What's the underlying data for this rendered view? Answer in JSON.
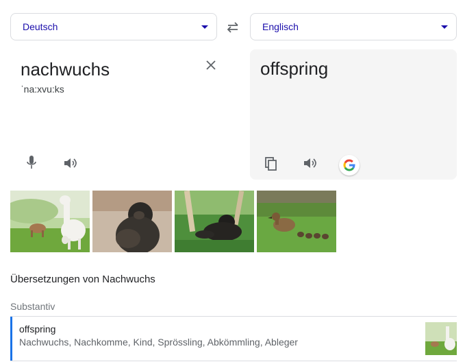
{
  "source_language": {
    "label": "Deutsch"
  },
  "target_language": {
    "label": "Englisch"
  },
  "swap_icon": "swap-horizontal-icon",
  "source": {
    "text": "nachwuchs",
    "phonetic": "ˈna:xvu:ks"
  },
  "target": {
    "text": "offspring"
  },
  "images": [
    {
      "depicts": "alpaca-photo"
    },
    {
      "depicts": "gorilla-photo"
    },
    {
      "depicts": "gorilla-photo"
    },
    {
      "depicts": "duck-photo"
    }
  ],
  "translations": {
    "heading": "Übersetzungen von Nachwuchs",
    "part_of_speech": "Substantiv",
    "entries": [
      {
        "word": "offspring",
        "synonyms": "Nachwuchs, Nachkomme, Kind, Sprössling, Abkömmling, Ableger"
      }
    ]
  },
  "colors": {
    "accent_link": "#1a0dab",
    "entry_bar": "#1a73e8",
    "target_panel": "#f5f5f5"
  }
}
